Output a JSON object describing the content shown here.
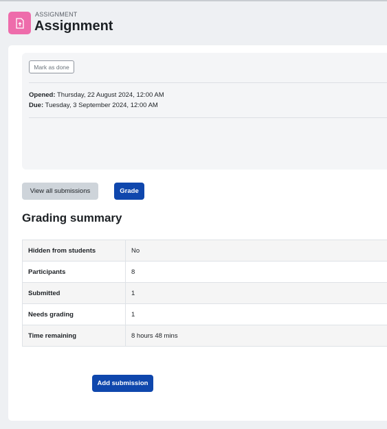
{
  "header": {
    "pretitle": "ASSIGNMENT",
    "title": "Assignment",
    "icon": "assignment-upload-icon",
    "icon_color": "#ee6cab"
  },
  "activity": {
    "mark_done_label": "Mark as done",
    "opened_label": "Opened:",
    "opened_value": "Thursday, 22 August 2024, 12:00 AM",
    "due_label": "Due:",
    "due_value": "Tuesday, 3 September 2024, 12:00 AM"
  },
  "actions": {
    "view_all_label": "View all submissions",
    "grade_label": "Grade"
  },
  "grading_summary": {
    "heading": "Grading summary",
    "rows": [
      {
        "label": "Hidden from students",
        "value": "No"
      },
      {
        "label": "Participants",
        "value": "8"
      },
      {
        "label": "Submitted",
        "value": "1"
      },
      {
        "label": "Needs grading",
        "value": "1"
      },
      {
        "label": "Time remaining",
        "value": "8 hours 48 mins"
      }
    ]
  },
  "submission": {
    "add_label": "Add submission"
  },
  "colors": {
    "primary": "#0f47ad",
    "secondary": "#ced4da"
  }
}
